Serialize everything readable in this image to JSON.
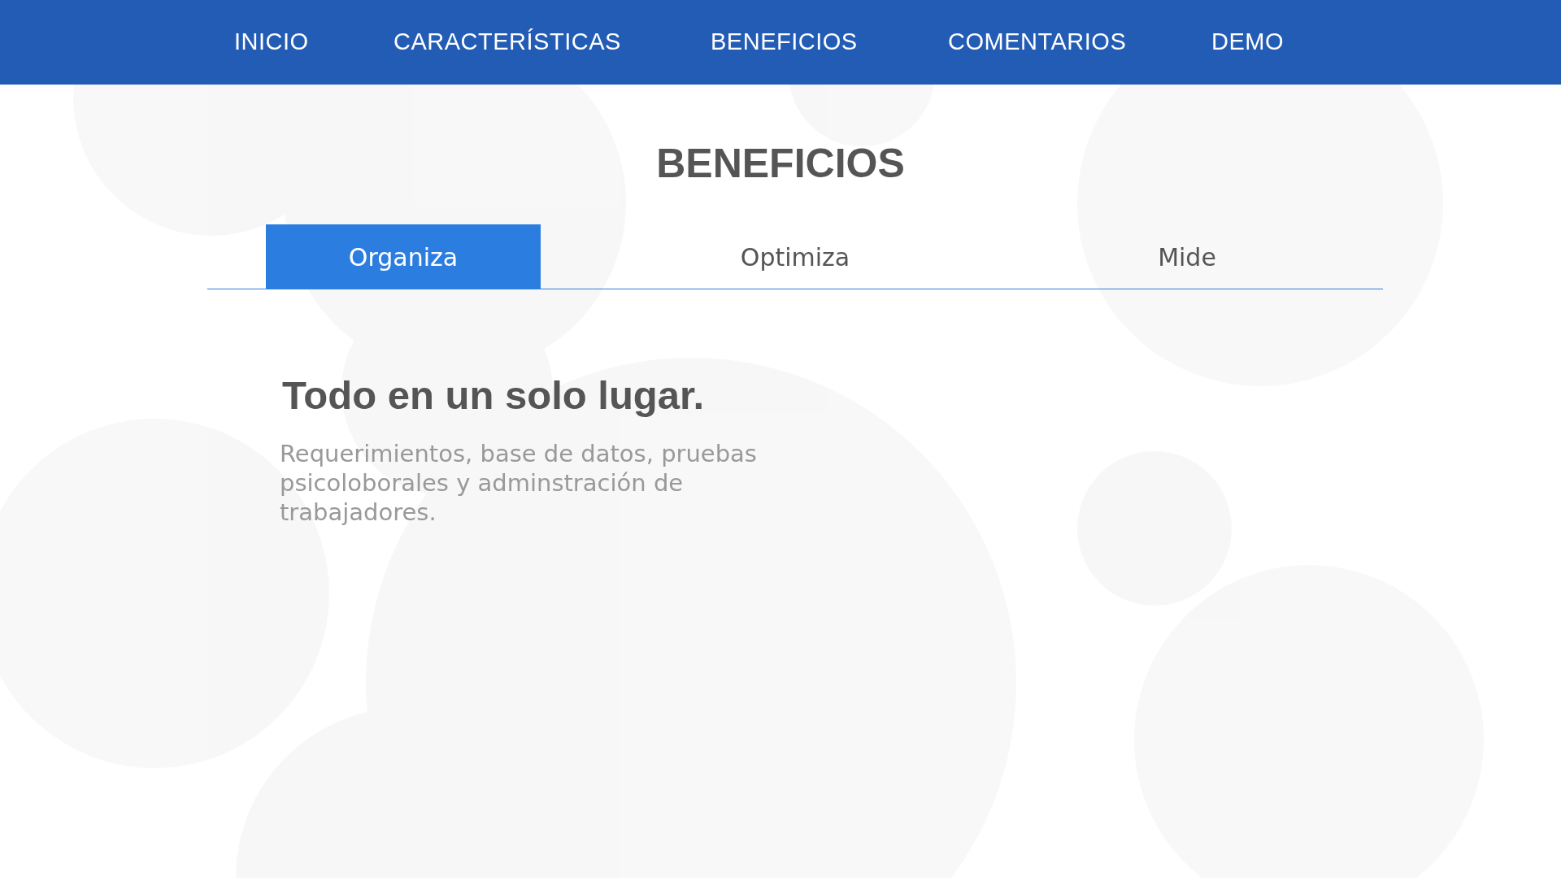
{
  "nav": {
    "items": [
      {
        "label": "INICIO"
      },
      {
        "label": "CARACTERÍSTICAS"
      },
      {
        "label": "BENEFICIOS"
      },
      {
        "label": "COMENTARIOS"
      },
      {
        "label": "DEMO"
      }
    ]
  },
  "section": {
    "title": "BENEFICIOS",
    "tabs": [
      {
        "label": "Organiza",
        "selected": true
      },
      {
        "label": "Optimiza",
        "selected": false
      },
      {
        "label": "Mide",
        "selected": false
      }
    ],
    "panel": {
      "heading": "Todo en un solo lugar.",
      "text": "Requerimientos, base de datos, pruebas psicoloborales y adminstración de trabajadores."
    }
  }
}
